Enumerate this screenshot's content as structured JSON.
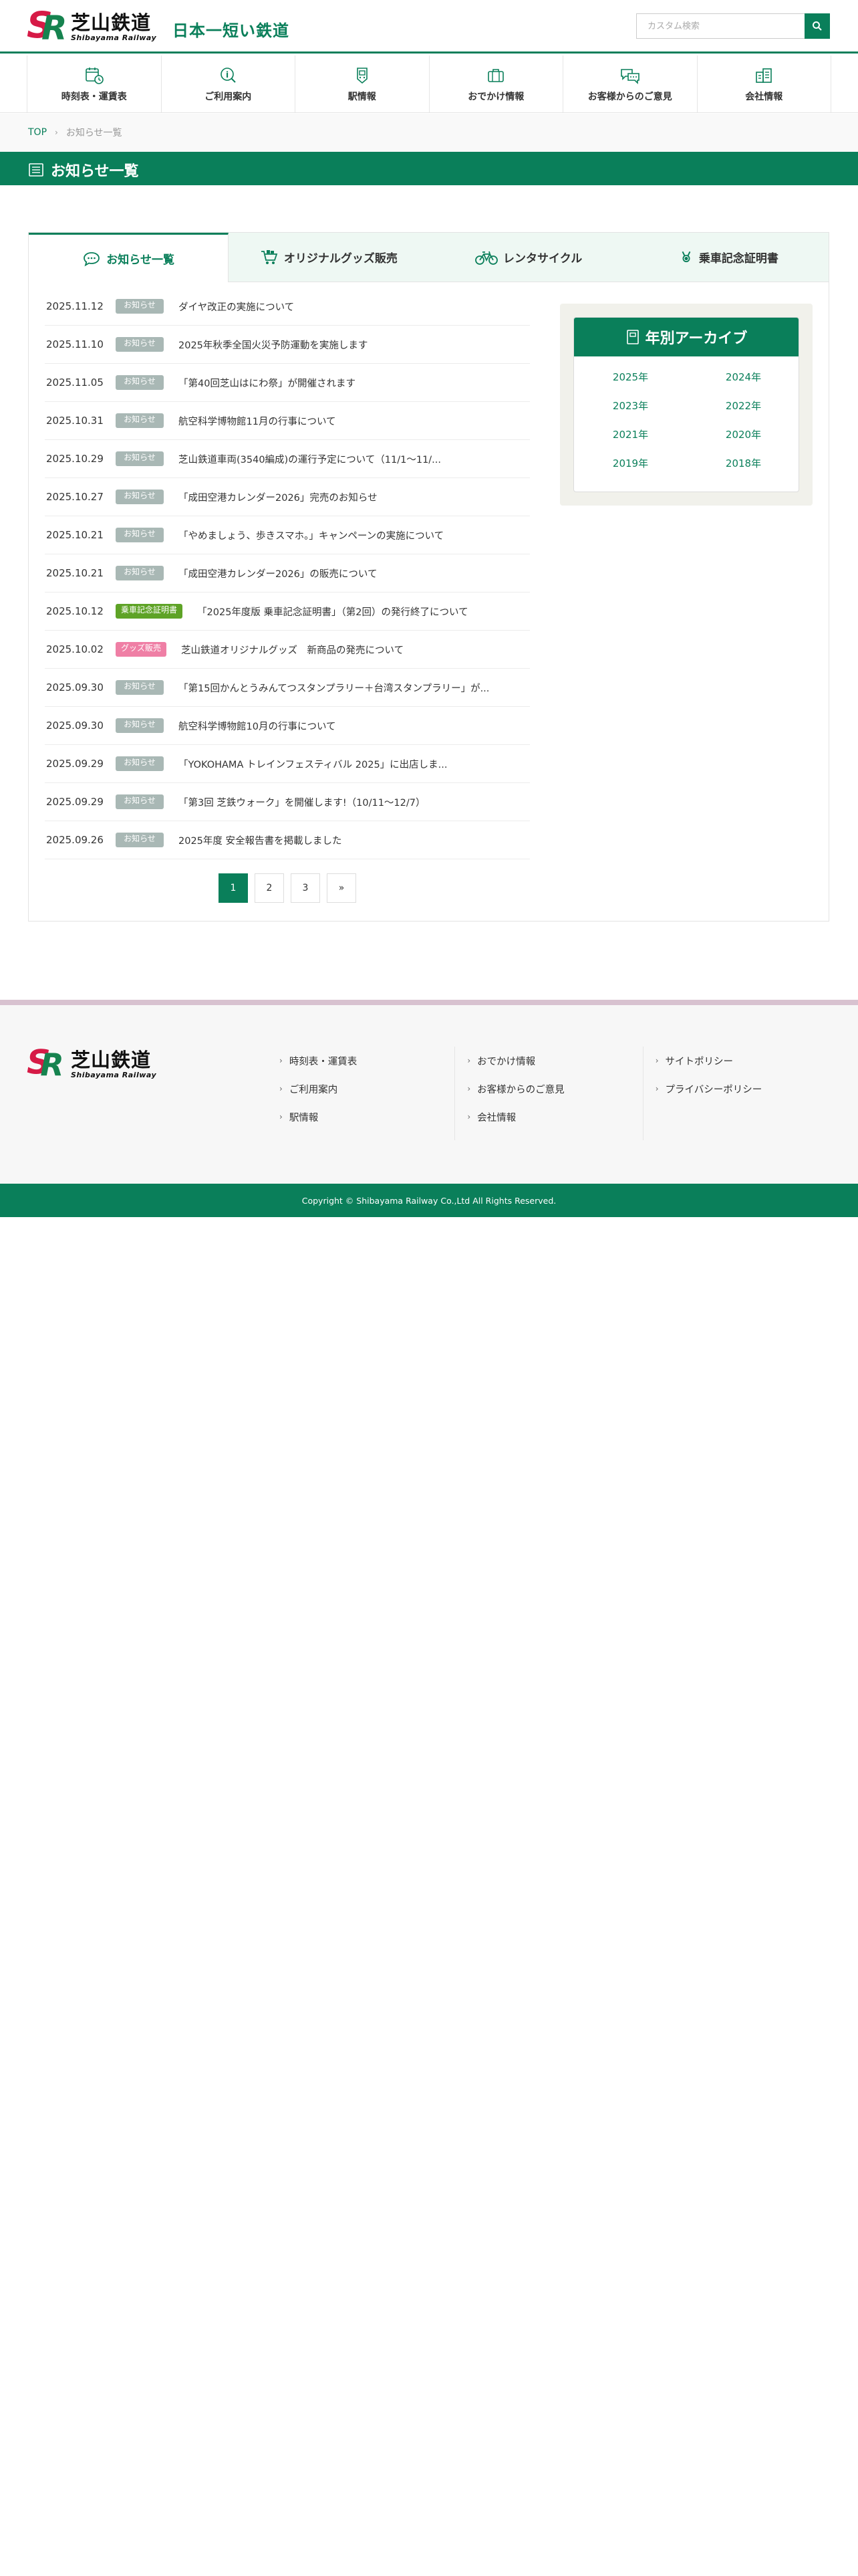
{
  "header": {
    "logo_jp": "芝山鉄道",
    "logo_en": "Shibayama Railway",
    "logo_letters": "SR",
    "tagline": "日本一短い鉄道",
    "search_placeholder": "カスタム検索"
  },
  "nav": {
    "items": [
      {
        "label": "時刻表・運賃表",
        "icon": "timetable-icon"
      },
      {
        "label": "ご利用案内",
        "icon": "guide-icon"
      },
      {
        "label": "駅情報",
        "icon": "station-icon"
      },
      {
        "label": "おでかけ情報",
        "icon": "outing-icon"
      },
      {
        "label": "お客様からのご意見",
        "icon": "feedback-icon"
      },
      {
        "label": "会社情報",
        "icon": "company-icon"
      }
    ]
  },
  "breadcrumb": {
    "home": "TOP",
    "separator": "›",
    "current": "お知らせ一覧"
  },
  "page_title": "お知らせ一覧",
  "tabs": [
    {
      "label": "お知らせ一覧",
      "active": true,
      "icon": "speech-bubble-icon"
    },
    {
      "label": "オリジナルグッズ販売",
      "active": false,
      "icon": "cart-icon"
    },
    {
      "label": "レンタサイクル",
      "active": false,
      "icon": "bicycle-icon"
    },
    {
      "label": "乗車記念証明書",
      "active": false,
      "icon": "medal-icon"
    }
  ],
  "news": [
    {
      "date": "2025.11.12",
      "badge": "お知らせ",
      "type": "info",
      "title": "ダイヤ改正の実施について"
    },
    {
      "date": "2025.11.10",
      "badge": "お知らせ",
      "type": "info",
      "title": "2025年秋季全国火災予防運動を実施します"
    },
    {
      "date": "2025.11.05",
      "badge": "お知らせ",
      "type": "info",
      "title": "「第40回芝山はにわ祭」が開催されます"
    },
    {
      "date": "2025.10.31",
      "badge": "お知らせ",
      "type": "info",
      "title": "航空科学博物館11月の行事について"
    },
    {
      "date": "2025.10.29",
      "badge": "お知らせ",
      "type": "info",
      "title": "芝山鉄道車両(3540編成)の運行予定について（11/1〜11/..."
    },
    {
      "date": "2025.10.27",
      "badge": "お知らせ",
      "type": "info",
      "title": "「成田空港カレンダー2026」完売のお知らせ"
    },
    {
      "date": "2025.10.21",
      "badge": "お知らせ",
      "type": "info",
      "title": "「やめましょう、歩きスマホ。」キャンペーンの実施について"
    },
    {
      "date": "2025.10.21",
      "badge": "お知らせ",
      "type": "info",
      "title": "「成田空港カレンダー2026」の販売について"
    },
    {
      "date": "2025.10.12",
      "badge": "乗車記念証明書",
      "type": "cert",
      "title": "「2025年度版 乗車記念証明書」（第2回）の発行終了について"
    },
    {
      "date": "2025.10.02",
      "badge": "グッズ販売",
      "type": "goods",
      "title": "芝山鉄道オリジナルグッズ　新商品の発売について"
    },
    {
      "date": "2025.09.30",
      "badge": "お知らせ",
      "type": "info",
      "title": "「第15回かんとうみんてつスタンプラリー＋台湾スタンプラリー」が..."
    },
    {
      "date": "2025.09.30",
      "badge": "お知らせ",
      "type": "info",
      "title": "航空科学博物館10月の行事について"
    },
    {
      "date": "2025.09.29",
      "badge": "お知らせ",
      "type": "info",
      "title": "「YOKOHAMA トレインフェスティバル 2025」に出店しま..."
    },
    {
      "date": "2025.09.29",
      "badge": "お知らせ",
      "type": "info",
      "title": "「第3回 芝鉄ウォーク」を開催します!（10/11〜12/7）"
    },
    {
      "date": "2025.09.26",
      "badge": "お知らせ",
      "type": "info",
      "title": "2025年度 安全報告書を掲載しました"
    }
  ],
  "pager": [
    "1",
    "2",
    "3",
    "»"
  ],
  "pager_current": "1",
  "archive": {
    "title": "年別アーカイブ",
    "years": [
      "2025年",
      "2024年",
      "2023年",
      "2022年",
      "2021年",
      "2020年",
      "2019年",
      "2018年"
    ]
  },
  "footer": {
    "logo_jp": "芝山鉄道",
    "logo_en": "Shibayama Railway",
    "columns": [
      [
        "時刻表・運賃表",
        "ご利用案内",
        "駅情報"
      ],
      [
        "おでかけ情報",
        "お客様からのご意見",
        "会社情報"
      ],
      [
        "サイトポリシー",
        "プライバシーポリシー"
      ]
    ],
    "copyright": "Copyright © Shibayama Railway Co.,Ltd All Rights Reserved."
  },
  "colors": {
    "brand_green": "#0a7f5a",
    "logo_red": "#d61a46",
    "badge_info": "#a9b8b5",
    "badge_cert": "#5ea326",
    "badge_goods": "#ef7fa5",
    "footer_accent": "#d8c2d0"
  }
}
